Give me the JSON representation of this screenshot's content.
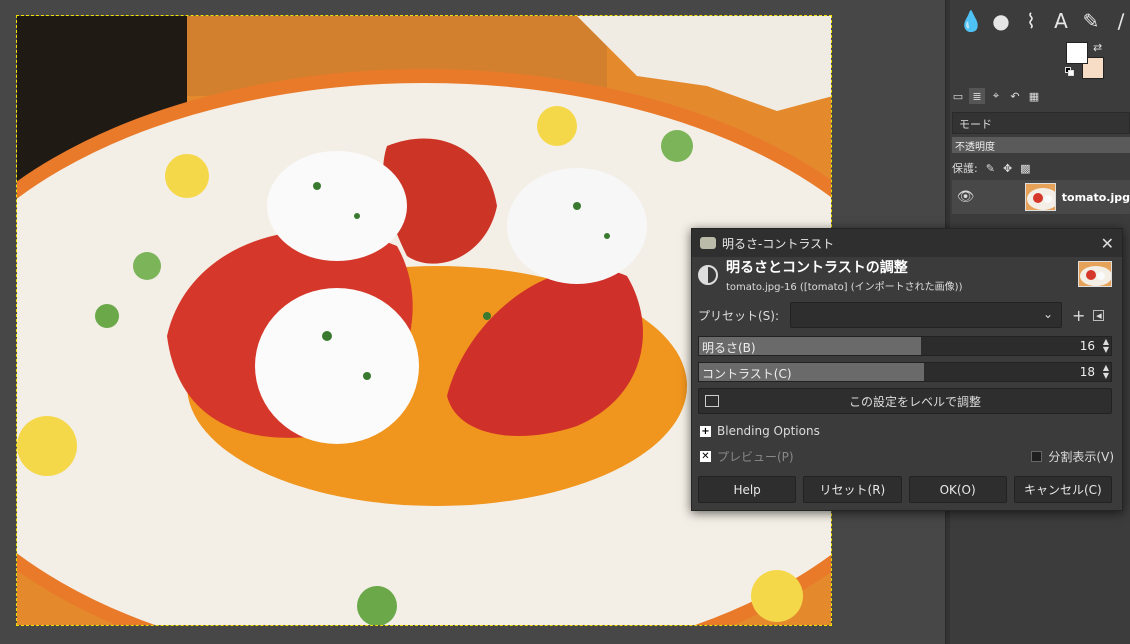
{
  "dialog": {
    "window_title": "明るさ-コントラスト",
    "main_title": "明るさとコントラストの調整",
    "subtitle": "tomato.jpg-16 ([tomato] (インポートされた画像))",
    "preset_label": "プリセット(S):",
    "preset_value": "",
    "brightness": {
      "label": "明るさ(B)",
      "value": "16",
      "fraction": 0.54
    },
    "contrast": {
      "label": "コントラスト(C)",
      "value": "18",
      "fraction": 0.545
    },
    "levels_button": "この設定をレベルで調整",
    "blending_options": "Blending Options",
    "preview_label": "プレビュー(P)",
    "split_view_label": "分割表示(V)",
    "buttons": {
      "help": "Help",
      "reset": "リセット(R)",
      "ok": "OK(O)",
      "cancel": "キャンセル(C)"
    }
  },
  "dock": {
    "mode_label": "モード",
    "opacity_label": "不透明度",
    "lock_label": "保護:",
    "layer_name": "tomato.jpg"
  },
  "colors": {
    "foreground": "#ffffff",
    "background": "#f7dcc6",
    "selection_outline": "#f2e000"
  }
}
